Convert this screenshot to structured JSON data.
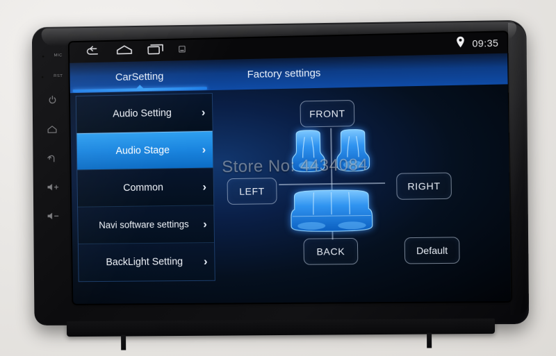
{
  "device": {
    "hardware_keys": [
      {
        "name": "mic",
        "label": "MIC"
      },
      {
        "name": "reset",
        "label": "RST"
      },
      {
        "name": "power",
        "label": "power-icon"
      },
      {
        "name": "home",
        "label": "home-icon"
      },
      {
        "name": "back",
        "label": "back-icon"
      },
      {
        "name": "volume-up",
        "label": "◁+"
      },
      {
        "name": "volume-down",
        "label": "◁-"
      }
    ]
  },
  "statusbar": {
    "nav": [
      {
        "name": "back",
        "icon": "back-arrow-icon"
      },
      {
        "name": "home",
        "icon": "home-icon"
      },
      {
        "name": "recents",
        "icon": "recents-icon"
      },
      {
        "name": "screenshot",
        "icon": "screenshot-icon"
      }
    ],
    "location_icon": "location-pin-icon",
    "clock": "09:35"
  },
  "tabs": [
    {
      "label": "CarSetting",
      "active": true
    },
    {
      "label": "Factory settings",
      "active": false
    }
  ],
  "sidebar": {
    "items": [
      {
        "label": "Audio Setting",
        "selected": false,
        "chevron": "›"
      },
      {
        "label": "Audio Stage",
        "selected": true,
        "chevron": "›"
      },
      {
        "label": "Common",
        "selected": false,
        "chevron": "›"
      },
      {
        "label": "Navi software settings",
        "selected": false,
        "chevron": "›"
      },
      {
        "label": "BackLight Setting",
        "selected": false,
        "chevron": "›"
      }
    ]
  },
  "audio_stage": {
    "buttons": {
      "front": "FRONT",
      "left": "LEFT",
      "right": "RIGHT",
      "back": "BACK",
      "default": "Default"
    },
    "diagram": {
      "name": "car-seats-diagram",
      "seats": [
        "front-left",
        "front-right",
        "rear-bench"
      ],
      "crosshair": true
    }
  },
  "watermark": "Store No: 4434084",
  "colors": {
    "accent_blue": "#1b86e0",
    "tab_blue": "#0f4ba6",
    "screen_black": "#05101f",
    "bezel_black": "#121214",
    "wall_gray": "#e9e7e5"
  }
}
